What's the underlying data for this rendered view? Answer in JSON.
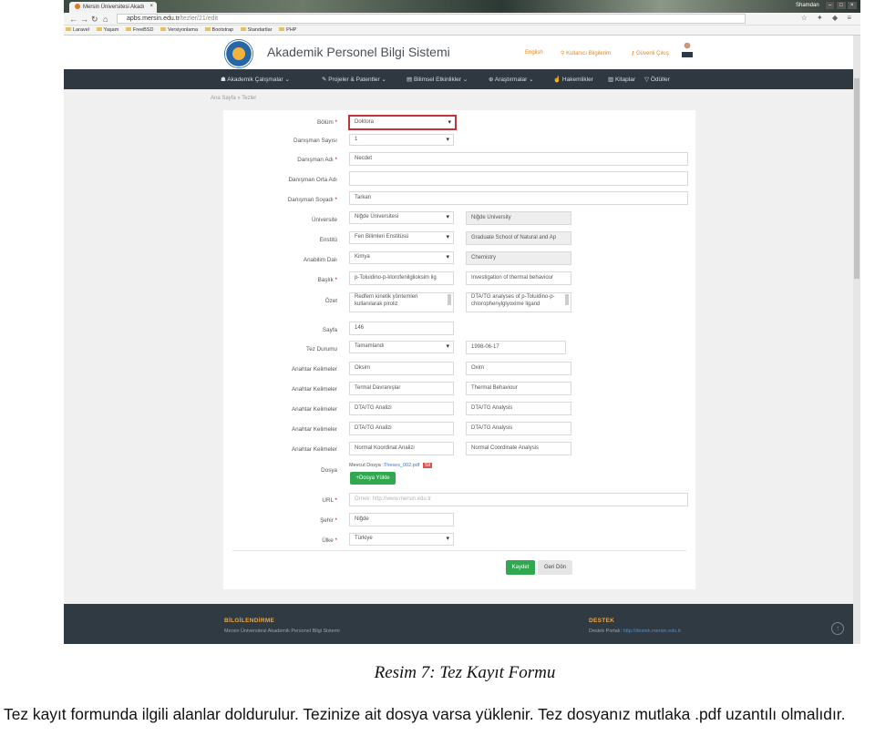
{
  "browser": {
    "tab_title": "Mersin Üniversitesi Akadı",
    "tab_close": "×",
    "url_host": "apbs.mersin.edu.tr",
    "url_path": "/tezler/21/edit",
    "window_user": "Shamdan",
    "bookmarks": [
      "Laravel",
      "Yaşam",
      "FreeBSD",
      "Versiyonlama",
      "Bootstrap",
      "Standartlar",
      "PHP"
    ]
  },
  "header": {
    "title": "Akademik Personel Bilgi Sistemi",
    "english": "English",
    "user_info": "Kullanıcı Bilgilerim",
    "logout": "Güvenli Çıkış"
  },
  "navbar": [
    "Akademik Çalışmalar",
    "Projeler & Patentler",
    "Bilimsel Etkinlikler",
    "Araştırmalar",
    "Hakemlikler",
    "Kitaplar",
    "Ödüller"
  ],
  "breadcrumb": "Ana Sayfa » Tezler",
  "form": {
    "bolum_label": "Bölüm",
    "bolum_value": "Doktora",
    "danisman_sayisi_label": "Danışman Sayısı",
    "danisman_sayisi_value": "1",
    "danisman_adi_label": "Danışman Adı",
    "danisman_adi_value": "Necdet",
    "danisman_orta_label": "Danışman Orta Adı",
    "danisman_orta_value": "",
    "danisman_soyadi_label": "Danışman Soyadı",
    "danisman_soyadi_value": "Tarkan",
    "universite_label": "Üniversite",
    "universite_tr": "Niğde Üniversitesi",
    "universite_en": "Niğde University",
    "enstitu_label": "Enstitü",
    "enstitu_tr": "Fen Bilimleri Enstitüsü",
    "enstitu_en": "Graduate School of Natural and Ap",
    "anabilim_label": "Anabilim Dalı",
    "anabilim_tr": "Kimya",
    "anabilim_en": "Chemistry",
    "baslik_label": "Başlık",
    "baslik_tr": "p-Toluidino-p-klorofenilglioksim lig",
    "baslik_en": "Investigation of thermal behaviour",
    "ozet_label": "Özet",
    "ozet_tr": "Redfern kinetik yöntemleri kullanılarak piroliz",
    "ozet_en": "DTA/TG analyses of p-Toluidino-p-chlorophenylglyoxime ligand",
    "sayfa_label": "Sayfa",
    "sayfa_value": "146",
    "tez_durumu_label": "Tez Durumu",
    "tez_durumu_value": "Tamamlandı",
    "tez_tarih": "1998-06-17",
    "anahtar_label": "Anahtar Kelimeler",
    "keywords": [
      {
        "tr": "Oksim",
        "en": "Oxim"
      },
      {
        "tr": "Termal Davranışlar",
        "en": "Thermal Behaviour"
      },
      {
        "tr": "DTA/TG Analizi",
        "en": "DTA/TG Analysis"
      },
      {
        "tr": "DTA/TG Analizi",
        "en": "DTA/TG Analysis"
      },
      {
        "tr": "Normal Koordinat Analizi",
        "en": "Normal Coordinate Analysis"
      }
    ],
    "dosya_label": "Dosya",
    "mevcut_dosya": "Mevcut Dosya :",
    "dosya_link": "Theses_002.pdf",
    "dosya_sil": "Sil",
    "dosya_yukle": "+Dosya Yükle",
    "url_label": "URL",
    "url_placeholder": "Örnek: http://www.mersin.edu.tr",
    "sehir_label": "Şehir",
    "sehir_value": "Niğde",
    "ulke_label": "Ülke",
    "ulke_value": "Türkiye",
    "required_mark": "*",
    "kaydet": "Kaydet",
    "geri_don": "Geri Dön"
  },
  "footer": {
    "bilgi_title": "BİLGİLENDİRME",
    "bilgi_text": "Mersin Üniversitesi Akademik Personel Bilgi Sistemi",
    "destek_title": "DESTEK",
    "destek_prefix": "Destek Portalı:",
    "destek_link": "http://destek.mersin.edu.tr"
  },
  "caption": "Resim 7: Tez Kayıt Formu",
  "paragraph": "Tez kayıt formunda ilgili alanlar doldurulur. Tezinize ait dosya varsa yüklenir. Tez dosyanız mutlaka .pdf uzantılı olmalıdır.",
  "colors": {
    "accent_red": "#c0343c",
    "button_green": "#2fa84f",
    "nav_bg": "#2f3840",
    "footer_heading": "#f0a640",
    "header_link": "#e4851d"
  }
}
